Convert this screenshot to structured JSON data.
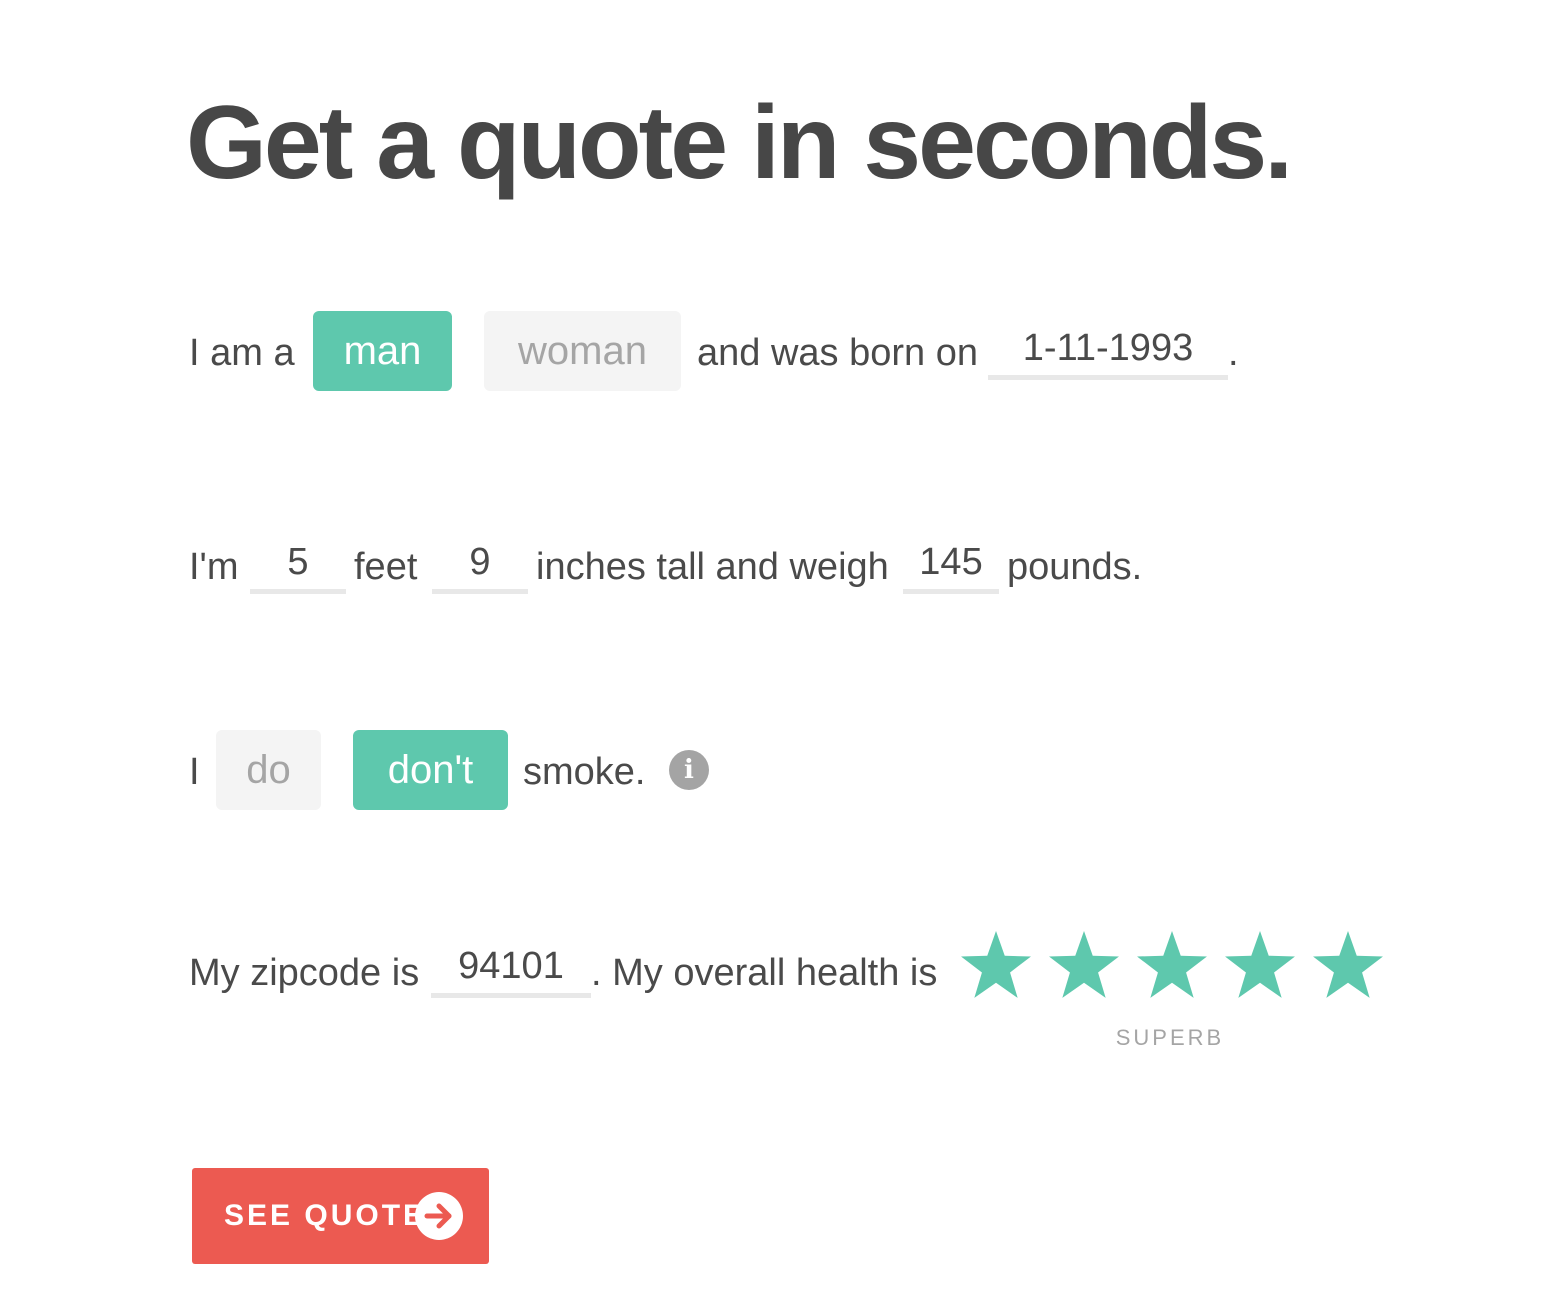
{
  "title": "Get a quote in seconds.",
  "row1": {
    "prefix": "I am a",
    "gender_options": [
      {
        "label": "man",
        "selected": true
      },
      {
        "label": "woman",
        "selected": false
      }
    ],
    "born_text": "and was born on",
    "birthdate": "1-11-1993",
    "suffix": "."
  },
  "row2": {
    "prefix": "I'm",
    "feet_value": "5",
    "feet_text": "feet",
    "inches_value": "9",
    "inches_text": "inches tall and weigh",
    "weight_value": "145",
    "suffix": "pounds."
  },
  "row3": {
    "prefix": "I",
    "smoke_options": [
      {
        "label": "do",
        "selected": false
      },
      {
        "label": "don't",
        "selected": true
      }
    ],
    "suffix": "smoke.",
    "info_icon": "info-icon",
    "info_glyph": "i"
  },
  "row4": {
    "prefix": "My zipcode is",
    "zipcode": "94101",
    "health_text": ". My overall health is",
    "health_rating": 5,
    "health_max": 5,
    "rating_label": "SUPERB"
  },
  "cta": {
    "label": "SEE QUOTE",
    "icon": "arrow-right-circle-icon"
  },
  "colors": {
    "accent": "#5ec8ad",
    "cta": "#ec5a51",
    "text": "#4a4a4a",
    "muted": "#a5a5a5",
    "chip_off": "#f4f4f4"
  }
}
